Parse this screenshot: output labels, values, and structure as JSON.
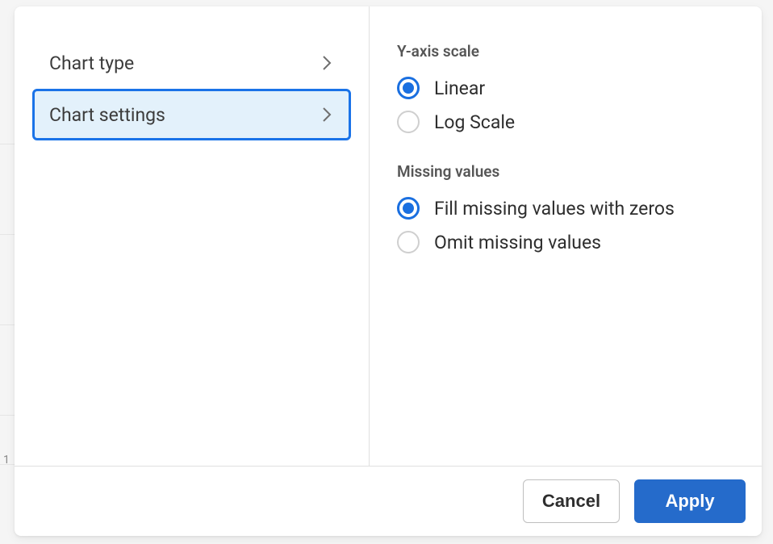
{
  "nav": {
    "items": [
      {
        "label": "Chart type",
        "selected": false
      },
      {
        "label": "Chart settings",
        "selected": true
      }
    ]
  },
  "settings": {
    "yaxis_scale": {
      "label": "Y-axis scale",
      "options": [
        {
          "label": "Linear",
          "checked": true
        },
        {
          "label": "Log Scale",
          "checked": false
        }
      ]
    },
    "missing_values": {
      "label": "Missing values",
      "options": [
        {
          "label": "Fill missing values with zeros",
          "checked": true
        },
        {
          "label": "Omit missing values",
          "checked": false
        }
      ]
    }
  },
  "footer": {
    "cancel_label": "Cancel",
    "apply_label": "Apply"
  },
  "background": {
    "tick": "1"
  }
}
